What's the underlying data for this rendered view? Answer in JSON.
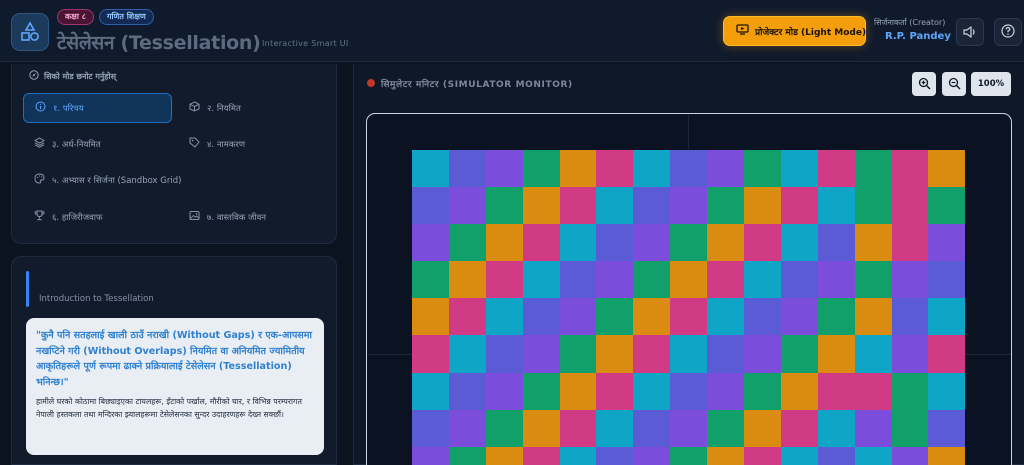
{
  "header": {
    "grade_badge": "कक्षा ८",
    "subject_badge": "गणित शिक्षण",
    "title": "टेसेलेसन (Tessellation)",
    "subtitle": "Interactive Smart UI",
    "projector_button": "प्रोजेक्टर मोड (Light Mode)",
    "creator_label": "सिर्जनाकर्ता (Creator)",
    "creator_name": "R.P. Pandey",
    "icons": [
      "logo-shapes-icon",
      "projector-icon",
      "volume-icon",
      "help-icon"
    ]
  },
  "mode_panel": {
    "heading": "सिको मोड छनोट गर्नुहोस्",
    "items": [
      {
        "label": "१. परिचय",
        "icon": "info-icon",
        "active": true
      },
      {
        "label": "२. नियमित",
        "icon": "cube-icon",
        "active": false
      },
      {
        "label": "३. अर्ध-नियमित",
        "icon": "layers-icon",
        "active": false
      },
      {
        "label": "४. नामकरण",
        "icon": "tag-icon",
        "active": false
      },
      {
        "label": "५. अभ्यास र सिर्जना (Sandbox Grid)",
        "icon": "palette-icon",
        "active": false
      },
      {
        "label": "६. हाजिरीजवाफ",
        "icon": "trophy-icon",
        "active": false
      },
      {
        "label": "७. वास्तविक जीवन",
        "icon": "image-icon",
        "active": false
      }
    ]
  },
  "intro": {
    "label": "Introduction to Tessellation",
    "quote": "\"कुनै पनि सतहलाई खाली ठाउँ नराखी (Without Gaps) र एक-आपसमा नखप्टिने गरी (Without Overlaps) नियमित वा अनियमित ज्यामितीय आकृतिहरूले पूर्ण रूपमा ढाक्ने प्रक्रियालाई टेसेलेसन (Tessellation) भनिन्छ।\"",
    "body": "हामीले घरको कोठामा बिछ्याइएका टायलहरू, इँटाको पर्खाल, मौरीको घार, र विभिन्न परम्परागत नेपाली हस्तकला तथा मन्दिरका झ्यालहरूमा टेसेलेसनका सुन्दर उदाहरणहरू देख्न सक्छौं।"
  },
  "simulator": {
    "title": "सिमुलेटर मनिटर (SIMULATOR MONITOR)",
    "zoom_level": "100%",
    "icons": [
      "zoom-in-icon",
      "zoom-out-icon"
    ],
    "palette": {
      "c": "#0ea5c6",
      "b": "#5b5bd6",
      "v": "#7c4ddb",
      "g": "#12a06a",
      "o": "#d98c0f",
      "p": "#d13a84"
    },
    "rows": [
      "cbvgopcbvgcpgpo",
      "bvgopcbvgopcgpg",
      "vgopcbvgopcbopv",
      "gopcbvgopcbvgvb",
      "opcbvgopcbvgobc",
      "pcbvgopcbvgocvp",
      "cbvgopcbvgoppgc",
      "bvgopcbvgopcvgb",
      "vgopcbvgopcbcvo"
    ]
  }
}
